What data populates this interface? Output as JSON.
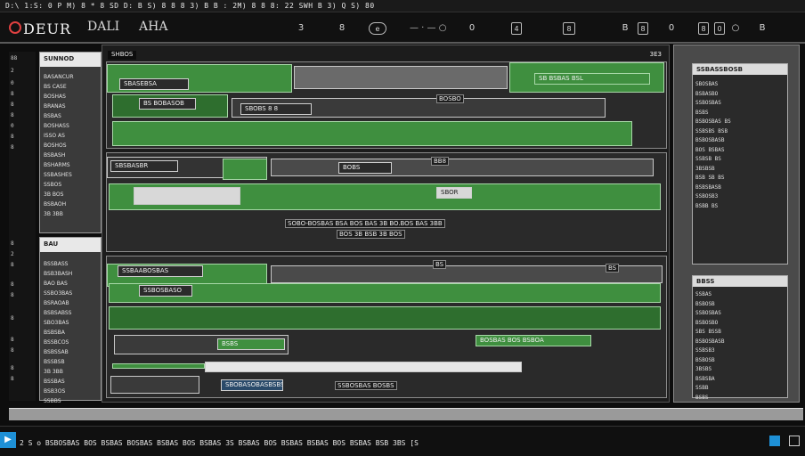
{
  "titlebar": {
    "menu_text": "D:\\ 1:S: 0 P M) 8 * 8 SD D: B S) 8 8 8 3) B B : 2M) 8 8 8: 22 SWH B 3) Q S) 80"
  },
  "header": {
    "logo_text": "DEUR",
    "menu_2": "DALI",
    "menu_3": "AHA",
    "btn_1": "3",
    "btn_2": "8",
    "btn_3": "e",
    "btn_4": "4",
    "btn_5": "8",
    "btn_6": "0",
    "btn_7": "8",
    "right_1": "B",
    "right_2": "8",
    "right_3": "0",
    "right_4": "8",
    "right_5": "0",
    "right_6": "B"
  },
  "left_strip": {
    "labels_top": [
      "88",
      "2",
      "0",
      "8",
      "8",
      "8",
      "0",
      "8",
      "8"
    ],
    "labels_bottom": [
      "8",
      "2",
      "8",
      "8",
      "8",
      "8",
      "8",
      "8",
      "8",
      "8"
    ]
  },
  "side_panel_top": {
    "heading": "SUNNOD",
    "lines": [
      "BASANCUR",
      "BS CASE",
      "BOSHAS",
      "BRANAS",
      "BSBAS",
      "BOSHASS",
      "ISSO AS",
      "BOSHOS",
      "BSBASH",
      "BSHARMS",
      "SSBASHES",
      "SSBOS",
      "3B BOS",
      "BSBAOH",
      "3B 3BB"
    ]
  },
  "side_panel_bottom": {
    "heading": "BAU",
    "lines": [
      "BSSBASS",
      "BSB3BASH",
      "BAO BAS",
      "SSBO3BAS",
      "BSRAOAB",
      "BSBSABSS",
      "SBO3BAS",
      "BSBSBA",
      "BSSBCOS",
      "BSBSSAB",
      "BSSBSB",
      "3B 3BB",
      "BSSBAS",
      "BSB3OS",
      "SSBBS"
    ]
  },
  "workspace": {
    "tab_left": "SHBOS",
    "tab_right": "3E3",
    "block1": {
      "label_a": "SBASEBSA",
      "label_b": "SB BSBAS BSL",
      "label_c": "BS BOBASOB",
      "label_d": "SBOBS 8 8",
      "bar_caption": "BOSBO"
    },
    "block2": {
      "label_a": "SBSBASBR",
      "label_b": "BOBS",
      "label_c": "BB8",
      "label_d": "SBOR",
      "caption_mid": "SOBO-BOSBAS BSA BOS BAS 3B BO.BOS BAS 3BB",
      "caption_sub": "BOS 3B BSB 3B BOS"
    },
    "block3": {
      "label_a": "SSBAABOSBAS",
      "label_b": "SSBOSBASO",
      "label_c": "BS",
      "label_d": "BS",
      "caption_right": "BOSBAS BOS BSBOA",
      "caption_low": "SBOBASOBASBSBS",
      "caption_left": "BSBS",
      "caption_mid": "SSBOSBAS BOSBS"
    }
  },
  "right_col": {
    "panel1": {
      "heading": "SSBASSBOSB",
      "lines": [
        "SBOSBAS",
        "BSBASBO",
        "SSBOSBAS",
        "BSBS",
        "BSBOSBAS BS",
        "SSBSBS BSB",
        "BSBOSBASB",
        "BOS BSBAS",
        "SSBSB BS",
        "3BSBSB",
        "BSB SB BS",
        "BSBSBASB",
        "SSBOSB3",
        "BSBB BS"
      ]
    },
    "panel2": {
      "heading": "BBSS",
      "lines": [
        "SSBAS",
        "BSBOSB",
        "SSBOSBAS",
        "BSBOSBO",
        "SBS BSSB",
        "BSBOSBASB",
        "SSBSB3",
        "BSBOSB",
        "3BSBS",
        "BSBSBA",
        "SSBB",
        "BSBS"
      ]
    }
  },
  "taskbar": {
    "start": "▶",
    "line": "2 S o  BSBOSBAS BOS  BSBAS  BOSBAS BSBAS BOS BSBAS  3S  BSBAS BOS BSBAS BSBAS BOS BSBAS  BSB  3BS  [S",
    "right_icon_a": "B",
    "right_icon_b": "B"
  },
  "colors": {
    "accent_green": "#3f8f3f",
    "accent_red": "#e04040",
    "start_blue": "#1e90d6"
  }
}
